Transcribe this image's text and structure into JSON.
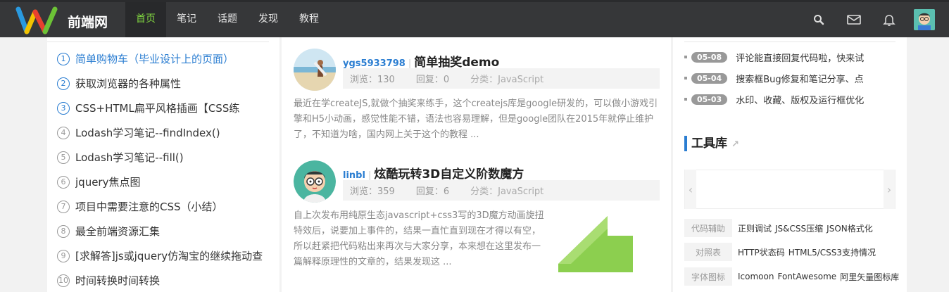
{
  "header": {
    "brand": "前端网",
    "nav": [
      "首页",
      "笔记",
      "话题",
      "发现",
      "教程"
    ],
    "icons": [
      "search-icon",
      "mail-icon",
      "bell-icon"
    ]
  },
  "left_list": [
    "简单购物车（毕业设计上的页面）",
    "获取浏览器的各种属性",
    "CSS+HTML扁平风格插画【CSS练",
    "Lodash学习笔记--findIndex()",
    "Lodash学习笔记--fill()",
    "jquery焦点图",
    "项目中需要注意的CSS（小结）",
    "最全前端资源汇集",
    "[求解答]js或jquery仿淘宝的继续拖动查",
    "时间转换时间转换"
  ],
  "posts": [
    {
      "user": "ygs5933798",
      "title": "简单抽奖demo",
      "views": "浏览：130",
      "replies": "回复：0",
      "category": "分类：JavaScript",
      "excerpt": "最近在学createJS,就做个抽奖来练手，这个createjs库是google研发的，可以做小游戏引擎和H5小动画，感觉性能不错，语法也容易理解，但是google团队在2015年就停止维护了，不知道为啥，国内网上关于这个的教程 ..."
    },
    {
      "user": "linbl",
      "title": "炫酷玩转3D自定义阶数魔方",
      "views": "浏览：359",
      "replies": "回复：6",
      "category": "分类：JavaScript",
      "excerpt": "自上次发布用纯原生态javascript+css3写的3D魔方动画旋扭特效后，说要加上事件的，结果一直忙直到现在才得以有空，所以赶紧把代码粘出来再次与大家分享，本来想在这里发布一篇解释原理性的文章的，结果发现这 ..."
    }
  ],
  "news": [
    {
      "date": "05-08",
      "text": "评论能直接回复代码啦，快来试"
    },
    {
      "date": "05-04",
      "text": "搜索框Bug修复和笔记分享、点"
    },
    {
      "date": "05-03",
      "text": "水印、收藏、版权及运行框优化"
    }
  ],
  "tools": {
    "title": "工具库",
    "rows": [
      {
        "label": "代码辅助",
        "links": [
          "正则调试",
          "JS&CSS压缩",
          "JSON格式化"
        ]
      },
      {
        "label": "对照表",
        "links": [
          "HTTP状态码",
          "HTML5/CSS3支持情况"
        ]
      },
      {
        "label": "字体图标",
        "links": [
          "Icomoon",
          "FontAwesome",
          "阿里矢量图标库"
        ]
      }
    ]
  },
  "colors": {
    "accent": "#2a7dd1",
    "nav_active": "#7fd340",
    "header_bg": "#363739"
  }
}
